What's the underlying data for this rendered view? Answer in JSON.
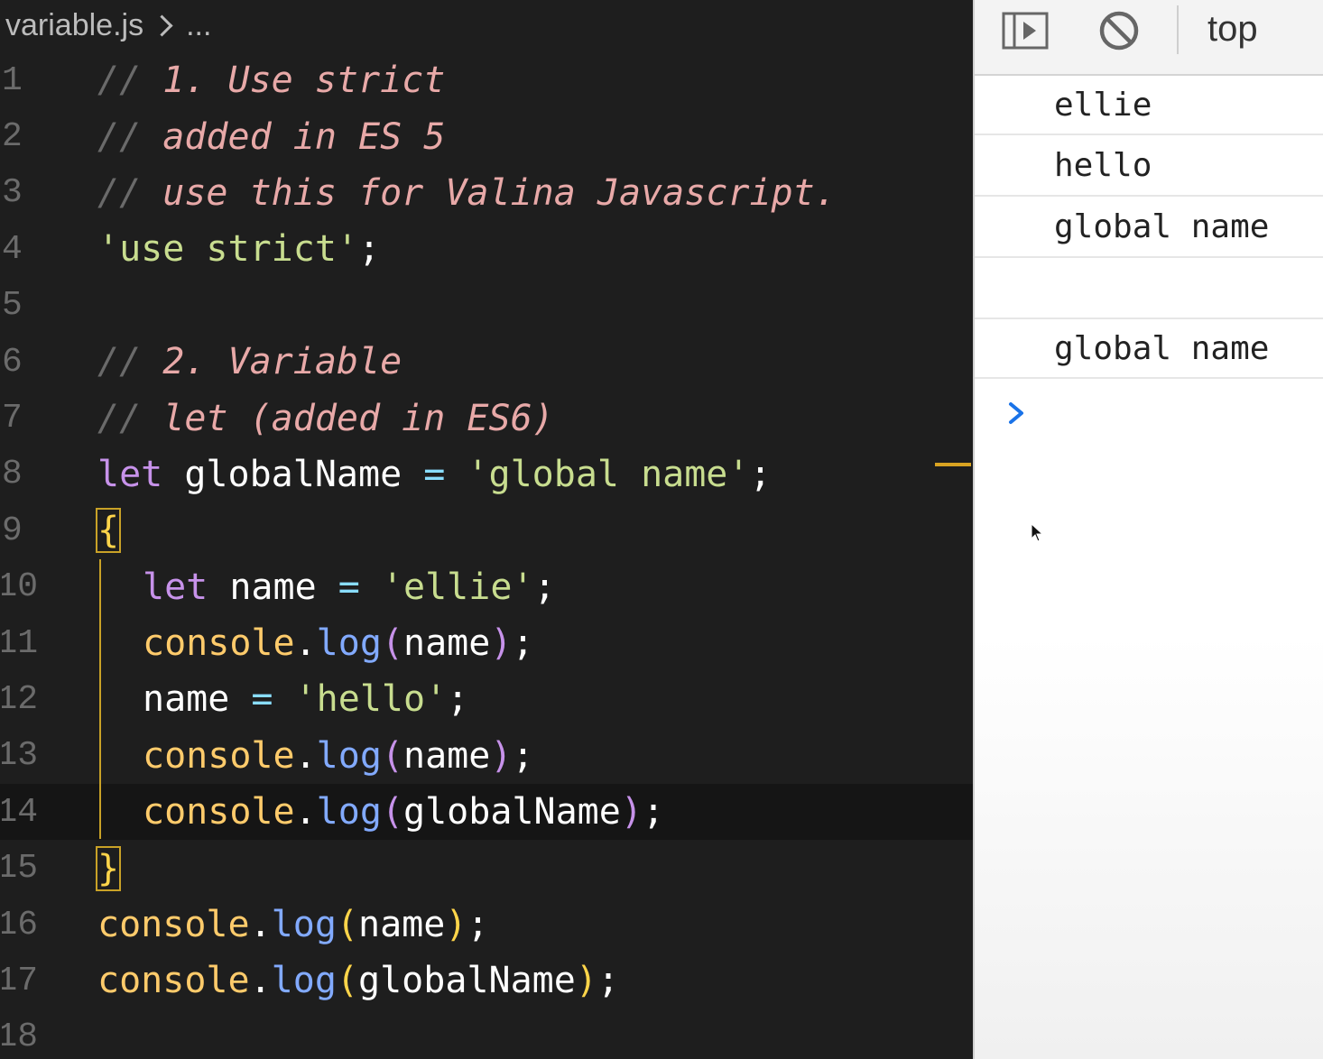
{
  "editor": {
    "breadcrumb": {
      "file": "variable.js",
      "rest": "..."
    },
    "lines": [
      {
        "num": "1",
        "indent": 0,
        "tokens": [
          [
            "cs",
            "// "
          ],
          [
            "c",
            "1. Use strict"
          ]
        ]
      },
      {
        "num": "2",
        "indent": 0,
        "tokens": [
          [
            "cs",
            "// "
          ],
          [
            "c",
            "added in ES 5"
          ]
        ]
      },
      {
        "num": "3",
        "indent": 0,
        "tokens": [
          [
            "cs",
            "// "
          ],
          [
            "c",
            "use this for Valina Javascript."
          ]
        ]
      },
      {
        "num": "4",
        "indent": 0,
        "tokens": [
          [
            "s",
            "'use strict'"
          ],
          [
            "p",
            ";"
          ]
        ]
      },
      {
        "num": "5",
        "indent": 0,
        "tokens": []
      },
      {
        "num": "6",
        "indent": 0,
        "tokens": [
          [
            "cs",
            "// "
          ],
          [
            "c",
            "2. Variable"
          ]
        ]
      },
      {
        "num": "7",
        "indent": 0,
        "tokens": [
          [
            "cs",
            "// "
          ],
          [
            "c",
            "let (added in ES6)"
          ]
        ]
      },
      {
        "num": "8",
        "indent": 0,
        "tokens": [
          [
            "k",
            "let "
          ],
          [
            "v",
            "globalName "
          ],
          [
            "o",
            "= "
          ],
          [
            "s",
            "'global name'"
          ],
          [
            "p",
            ";"
          ]
        ]
      },
      {
        "num": "9",
        "indent": 0,
        "tokens": [
          [
            "brace",
            "{"
          ]
        ]
      },
      {
        "num": "10",
        "indent": 1,
        "tokens": [
          [
            "k",
            "let "
          ],
          [
            "v",
            "name "
          ],
          [
            "o",
            "= "
          ],
          [
            "s",
            "'ellie'"
          ],
          [
            "p",
            ";"
          ]
        ]
      },
      {
        "num": "11",
        "indent": 1,
        "tokens": [
          [
            "f",
            "console"
          ],
          [
            "p",
            "."
          ],
          [
            "m",
            "log"
          ],
          [
            "pr",
            "("
          ],
          [
            "v",
            "name"
          ],
          [
            "pr",
            ")"
          ],
          [
            "p",
            ";"
          ]
        ]
      },
      {
        "num": "12",
        "indent": 1,
        "tokens": [
          [
            "v",
            "name "
          ],
          [
            "o",
            "= "
          ],
          [
            "s",
            "'hello'"
          ],
          [
            "p",
            ";"
          ]
        ]
      },
      {
        "num": "13",
        "indent": 1,
        "tokens": [
          [
            "f",
            "console"
          ],
          [
            "p",
            "."
          ],
          [
            "m",
            "log"
          ],
          [
            "pr",
            "("
          ],
          [
            "v",
            "name"
          ],
          [
            "pr",
            ")"
          ],
          [
            "p",
            ";"
          ]
        ]
      },
      {
        "num": "14",
        "indent": 1,
        "current": true,
        "tokens": [
          [
            "f",
            "console"
          ],
          [
            "p",
            "."
          ],
          [
            "m",
            "log"
          ],
          [
            "pr",
            "("
          ],
          [
            "v",
            "globalName"
          ],
          [
            "pr",
            ")"
          ],
          [
            "p",
            ";"
          ]
        ]
      },
      {
        "num": "15",
        "indent": 0,
        "tokens": [
          [
            "brace",
            "}"
          ]
        ]
      },
      {
        "num": "16",
        "indent": 0,
        "tokens": [
          [
            "f",
            "console"
          ],
          [
            "p",
            "."
          ],
          [
            "m",
            "log"
          ],
          [
            "b",
            "("
          ],
          [
            "v",
            "name"
          ],
          [
            "b",
            ")"
          ],
          [
            "p",
            ";"
          ]
        ]
      },
      {
        "num": "17",
        "indent": 0,
        "tokens": [
          [
            "f",
            "console"
          ],
          [
            "p",
            "."
          ],
          [
            "m",
            "log"
          ],
          [
            "b",
            "("
          ],
          [
            "v",
            "globalName"
          ],
          [
            "b",
            ")"
          ],
          [
            "p",
            ";"
          ]
        ]
      },
      {
        "num": "18",
        "indent": 0,
        "tokens": []
      }
    ]
  },
  "console": {
    "context": "top",
    "icons": {
      "sidebar": "sidebar-toggle-icon",
      "clear": "clear-console-icon",
      "prompt": "chevron-right-icon"
    },
    "messages": [
      "ellie",
      "hello",
      "global name",
      "",
      "global name"
    ]
  },
  "colors": {
    "editor_bg": "#1e1e1e",
    "comment": "#e8a9a8",
    "string": "#c8dd8f",
    "keyword": "#c792ea",
    "object": "#ffcb6b",
    "method": "#82aaff",
    "console_bg": "#ffffff",
    "prompt": "#1a73e8"
  }
}
